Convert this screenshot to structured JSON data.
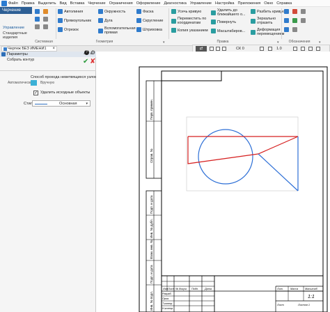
{
  "menu": [
    "Файл",
    "Правка",
    "Выделить",
    "Вид",
    "Вставка",
    "Черчение",
    "Ограничения",
    "Оформление",
    "Диагностика",
    "Управление",
    "Настройка",
    "Приложения",
    "Окно",
    "Справка"
  ],
  "ribbon": {
    "active_tab": "Черчение",
    "left_tabs": [
      "Управление",
      "Стандартные изделия"
    ],
    "group1_label": "Системная",
    "buttons": {
      "autoline": "Автолиния",
      "circle": "Окружность",
      "chamfer": "Фаска",
      "trim": "Усечь кривую",
      "remove_near": "Удалить до ближайшего о...",
      "break_curve": "Разбить кривую",
      "rectangle": "Прямоугольник",
      "arc": "Дуга",
      "fillet": "Скругление",
      "move_coords": "Переместить по координатам",
      "rotate": "Повернуть",
      "mirror": "Зеркально отразить",
      "segment": "Отрезок",
      "aux_line": "Вспомогательная прямая",
      "hatch": "Штриховка",
      "copy_shown": "Копия указанием",
      "scale": "Масштабиров...",
      "deform_move": "Деформация перемещением"
    },
    "group_geometry": "Геометрия",
    "group_edit": "Правка",
    "group_designation": "Обозначения"
  },
  "doc_tab": "Чертеж БЕЗ ИМЕНИ1",
  "panel": {
    "title": "Параметры",
    "command": "Собрать контур",
    "section_title": "Способ прохода неветвящихся узлов",
    "mode_auto": "Автоматически",
    "mode_manual": "Вручную",
    "delete_source_checked": true,
    "delete_source_label": "Удалить исходные объекты",
    "style_label": "Стиль",
    "style_value": "Основная"
  },
  "view_toolbar": {
    "layer": "СК 0",
    "zoom": "1.0"
  },
  "title_block": {
    "col_izm": "Изм",
    "col_list": "Лист",
    "col_doc": "№ докум.",
    "col_sign": "Подп.",
    "col_date": "Дата",
    "row_razrab": "Разраб.",
    "row_prov": "Пров.",
    "row_tkontr": "Т.контр.",
    "row_nkontr": "Н.контр.",
    "row_utv": "Утв.",
    "lit": "Лит.",
    "mass": "Масса",
    "scale": "Масштаб",
    "scale_value": "1:1",
    "sheet": "Лист",
    "sheets": "Листов 1",
    "left_strip_1": "Перв. примен.",
    "left_strip_2": "Справ. №",
    "left_strip_3": "Подп. и дата",
    "left_strip_4": "Инв. № дубл.",
    "left_strip_5": "Взам. инв. №",
    "left_strip_6": "Подп. и дата",
    "left_strip_7": "Инв. № подл."
  },
  "colors": {
    "frame": "#000000",
    "circle": "#2d6fd6",
    "contour": "#d62020",
    "ribbon_tab": "#2d5f95",
    "ok": "#2a9a3a",
    "cancel": "#dd3333"
  }
}
